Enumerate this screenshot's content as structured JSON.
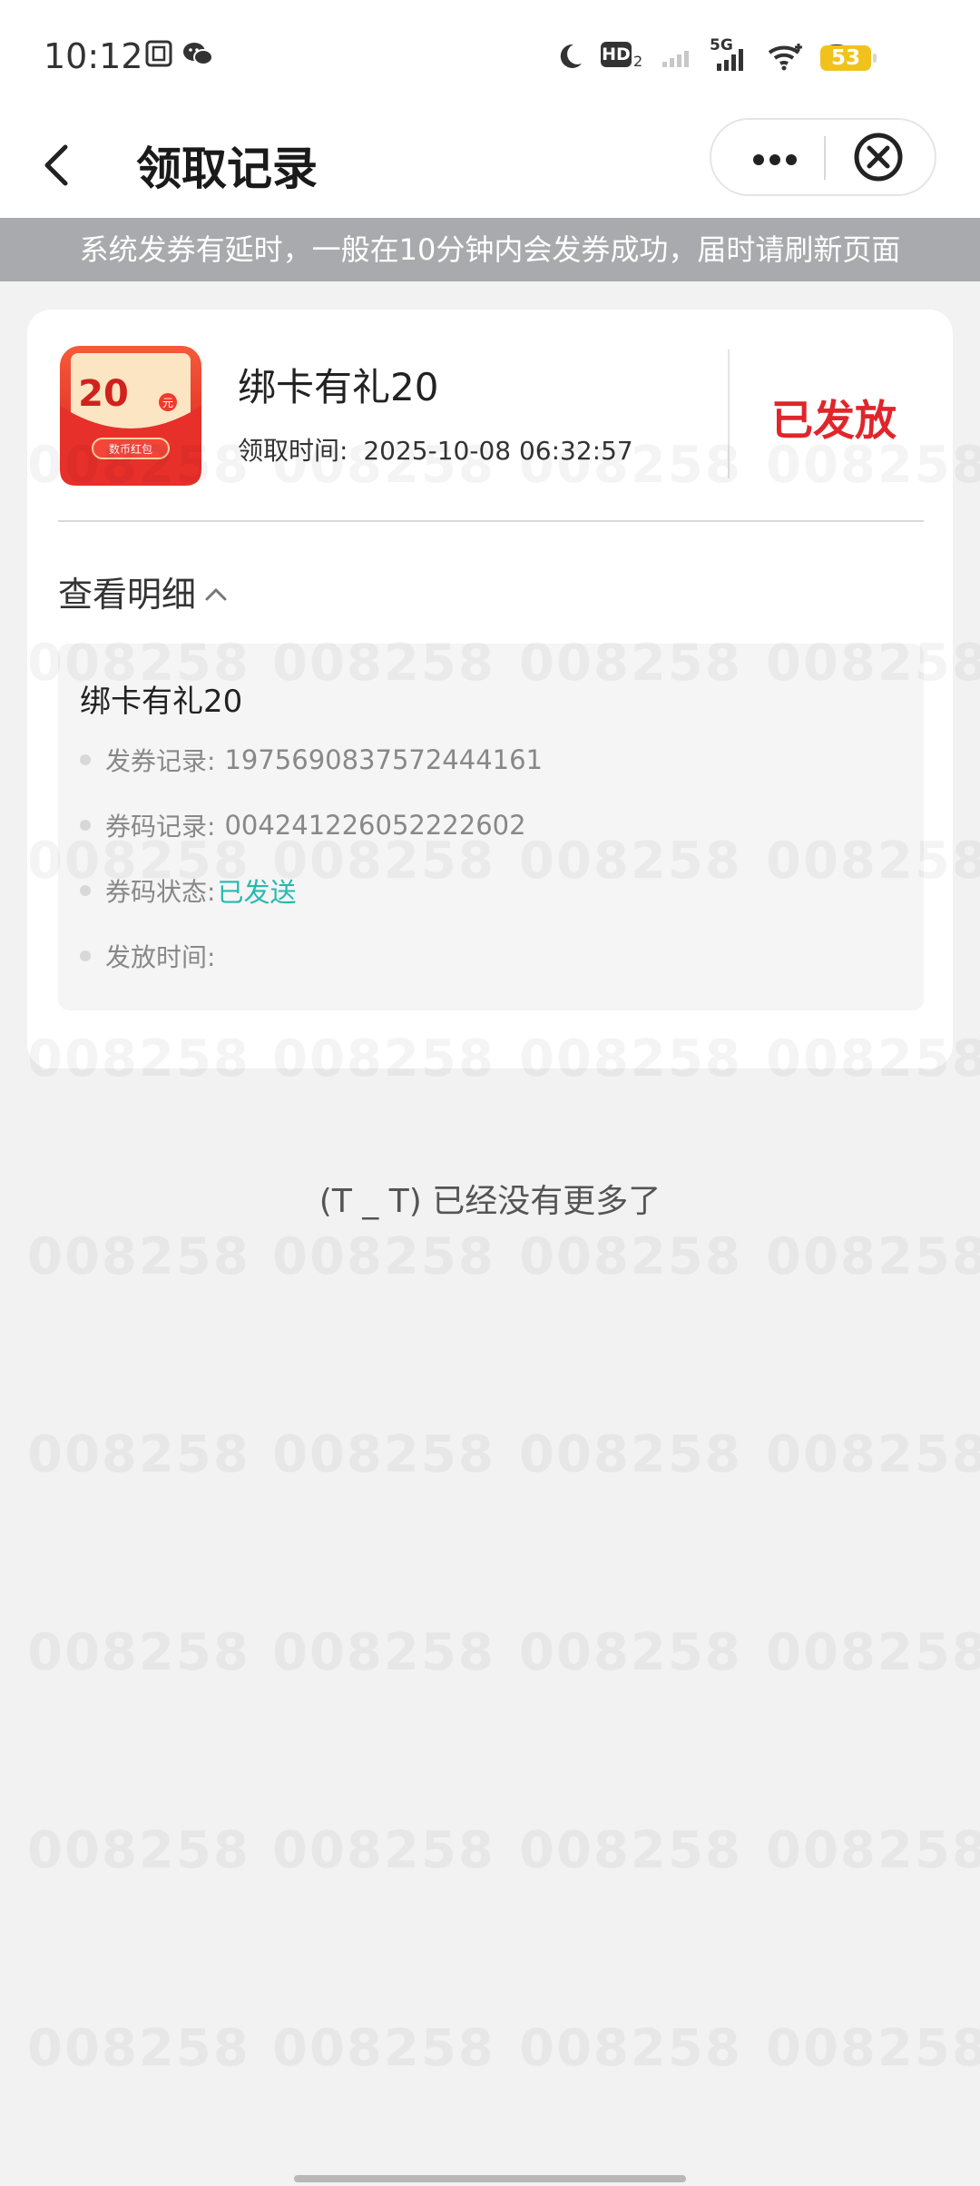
{
  "status_bar": {
    "time": "10:12",
    "left_icons": [
      "screen-record-icon",
      "wechat-icon"
    ],
    "right_icons": [
      "moon-icon",
      "hd-icon",
      "signal-weak-icon",
      "signal-5g-icon",
      "wifi-calling-icon",
      "wifi-icon"
    ],
    "hd_label": "HD",
    "network_label": "5G",
    "battery": "53",
    "battery_color": "#f1c21b"
  },
  "header": {
    "title": "领取记录",
    "back_icon": "chevron-left-icon",
    "more_icon": "more-dots-icon",
    "close_icon": "close-circle-icon"
  },
  "notice": {
    "text": "系统发券有延时，一般在10分钟内会发券成功，届时请刷新页面"
  },
  "record": {
    "coupon_image": {
      "amount": "20",
      "unit": "元",
      "caption": "数币红包"
    },
    "name": "绑卡有礼20",
    "time_label": "领取时间:",
    "time_value": "2025-10-08 06:32:57",
    "status": "已发放",
    "status_color": "#e0262b",
    "detail_toggle": "查看明细",
    "detail": {
      "title": "绑卡有礼20",
      "rows": [
        {
          "label": "发券记录:",
          "value": "1975690837572444161"
        },
        {
          "label": "券码记录:",
          "value": "004241226052222602"
        },
        {
          "label": "券码状态:",
          "value": "已发送"
        },
        {
          "label": "发放时间:",
          "value": ""
        }
      ],
      "status_value_color": "#26b9ae"
    }
  },
  "footer": {
    "no_more_text": "(T _ T) 已经没有更多了"
  },
  "watermark": {
    "text": "008258"
  }
}
